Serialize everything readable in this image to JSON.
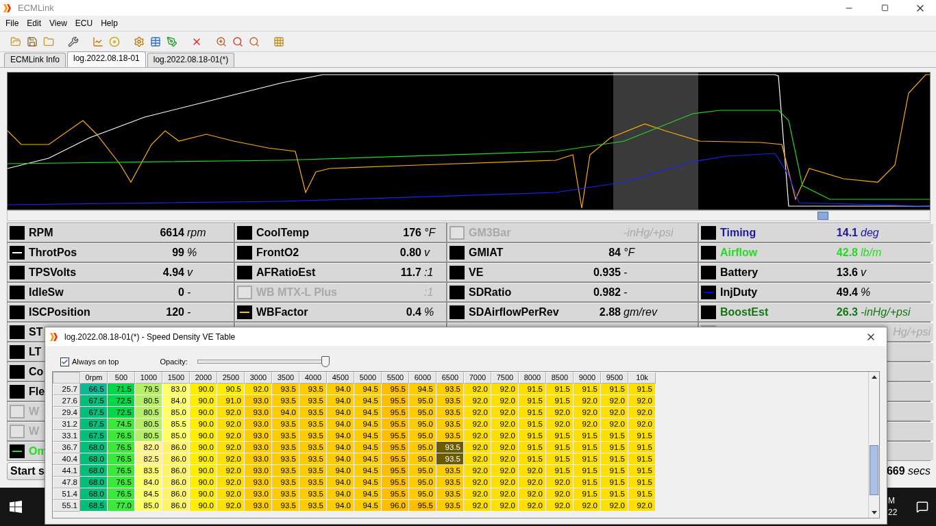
{
  "window": {
    "title": "ECMLink"
  },
  "menu": [
    "File",
    "Edit",
    "View",
    "ECU",
    "Help"
  ],
  "tabs": [
    {
      "label": "ECMLink Info",
      "selected": false
    },
    {
      "label": "log.2022.08.18-01",
      "selected": true
    },
    {
      "label": "log.2022.08.18-01(*)",
      "selected": false
    }
  ],
  "gauges": {
    "rows": [
      [
        {
          "name": "RPM",
          "value": "6614",
          "unit": "rpm",
          "disabled": false,
          "swatch": {
            "kind": "box"
          }
        },
        {
          "name": "CoolTemp",
          "value": "176",
          "unit": "°F",
          "disabled": false,
          "swatch": {
            "kind": "box"
          }
        },
        {
          "name": "GM3Bar",
          "unit": "-inHg/+psi",
          "disabled": true
        },
        {
          "name": "Timing",
          "value": "14.1",
          "unit": "deg",
          "color": "#1a1a9c",
          "disabled": false,
          "swatch": {
            "kind": "box"
          }
        }
      ],
      [
        {
          "name": "ThrotPos",
          "value": "99",
          "unit": "%",
          "disabled": false,
          "swatch": {
            "kind": "line",
            "color": "#ffffff"
          }
        },
        {
          "name": "FrontO2",
          "value": "0.80",
          "unit": "v",
          "disabled": false,
          "swatch": {
            "kind": "box"
          }
        },
        {
          "name": "GMIAT",
          "value": "84",
          "unit": "°F",
          "disabled": false,
          "swatch": {
            "kind": "box"
          }
        },
        {
          "name": "Airflow",
          "value": "42.8",
          "unit": "lb/m",
          "color": "#22dd22",
          "disabled": false,
          "swatch": {
            "kind": "box"
          }
        }
      ],
      [
        {
          "name": "TPSVolts",
          "value": "4.94",
          "unit": "v",
          "disabled": false,
          "swatch": {
            "kind": "box"
          }
        },
        {
          "name": "AFRatioEst",
          "value": "11.7",
          "unit": ":1",
          "disabled": false,
          "swatch": {
            "kind": "box"
          }
        },
        {
          "name": "VE",
          "value": "0.935",
          "unit": "-",
          "disabled": false,
          "swatch": {
            "kind": "box"
          }
        },
        {
          "name": "Battery",
          "value": "13.6",
          "unit": "v",
          "disabled": false,
          "swatch": {
            "kind": "box"
          }
        }
      ],
      [
        {
          "name": "IdleSw",
          "value": "0",
          "unit": "-",
          "disabled": false,
          "swatch": {
            "kind": "box"
          }
        },
        {
          "name": "WB MTX-L Plus",
          "unit": ":1",
          "disabled": true
        },
        {
          "name": "SDRatio",
          "value": "0.982",
          "unit": "-",
          "disabled": false,
          "swatch": {
            "kind": "box"
          }
        },
        {
          "name": "InjDuty",
          "value": "49.4",
          "unit": "%",
          "disabled": false,
          "swatch": {
            "kind": "line",
            "color": "#0000ff"
          }
        }
      ],
      [
        {
          "name": "ISCPosition",
          "value": "120",
          "unit": "-",
          "disabled": false,
          "swatch": {
            "kind": "box"
          }
        },
        {
          "name": "WBFactor",
          "value": "0.4",
          "unit": "%",
          "disabled": false,
          "swatch": {
            "kind": "line",
            "color": "#ffc000"
          }
        },
        {
          "name": "SDAirflowPerRev",
          "value": "2.88",
          "unit": "gm/rev",
          "disabled": false,
          "swatch": {
            "kind": "box"
          }
        },
        {
          "name": "BoostEst",
          "value": "26.3",
          "unit": "-inHg/+psi",
          "color": "#117711",
          "disabled": false,
          "swatch": {
            "kind": "box"
          }
        }
      ]
    ],
    "covered_rows": [
      {
        "left": {
          "name": "ST",
          "disabled": false,
          "swatch": {
            "kind": "box"
          }
        },
        "right": {
          "unit": "Hg/+psi",
          "disabled": true
        }
      },
      {
        "left": {
          "name": "LT",
          "disabled": false,
          "swatch": {
            "kind": "box"
          }
        }
      },
      {
        "left": {
          "name": "Co",
          "disabled": false,
          "swatch": {
            "kind": "box"
          }
        }
      },
      {
        "left": {
          "name": "Fle",
          "disabled": false,
          "swatch": {
            "kind": "box"
          }
        }
      },
      {
        "left": {
          "name": "W",
          "disabled": true
        }
      },
      {
        "left": {
          "name": "W",
          "disabled": true
        }
      },
      {
        "left": {
          "name": "Om",
          "color": "#22dd22",
          "disabled": false,
          "swatch": {
            "kind": "line",
            "color": "#22dd22"
          }
        }
      }
    ]
  },
  "footer": {
    "button": "Start s",
    "elapsed": "669",
    "elapsed_unit": "secs"
  },
  "taskbar": {
    "clock": [
      "M",
      "22"
    ]
  },
  "dialog": {
    "title": "log.2022.08.18-01(*) - Speed Density VE Table",
    "always_on_top": {
      "label": "Always on top",
      "checked": true
    },
    "opacity": {
      "label": "Opacity:",
      "level": 0.97
    },
    "table": {
      "columns": [
        "0rpm",
        "500",
        "1000",
        "1500",
        "2000",
        "2500",
        "3000",
        "3500",
        "4000",
        "4500",
        "5000",
        "5500",
        "6000",
        "6500",
        "7000",
        "7500",
        "8000",
        "8500",
        "9000",
        "9500",
        "10k"
      ],
      "rows": [
        {
          "label": "25.7",
          "cells": [
            {
              "value": "66.5",
              "selected": false
            },
            {
              "value": "71.5",
              "selected": false
            },
            {
              "value": "79.5",
              "selected": false
            },
            {
              "value": "83.0",
              "selected": false
            },
            {
              "value": "90.0",
              "selected": false
            },
            {
              "value": "90.5",
              "selected": false
            },
            {
              "value": "92.0",
              "selected": false
            },
            {
              "value": "93.5",
              "selected": false
            },
            {
              "value": "93.5",
              "selected": false
            },
            {
              "value": "94.0",
              "selected": false
            },
            {
              "value": "94.5",
              "selected": false
            },
            {
              "value": "95.5",
              "selected": false
            },
            {
              "value": "94.5",
              "selected": false
            },
            {
              "value": "93.5",
              "selected": false
            },
            {
              "value": "92.0",
              "selected": false
            },
            {
              "value": "92.0",
              "selected": false
            },
            {
              "value": "91.5",
              "selected": false
            },
            {
              "value": "91.5",
              "selected": false
            },
            {
              "value": "91.5",
              "selected": false
            },
            {
              "value": "91.5",
              "selected": false
            },
            {
              "value": "91.5",
              "selected": false
            }
          ]
        },
        {
          "label": "27.6",
          "cells": [
            {
              "value": "67.5",
              "selected": false
            },
            {
              "value": "72.5",
              "selected": false
            },
            {
              "value": "80.5",
              "selected": false
            },
            {
              "value": "84.0",
              "selected": false
            },
            {
              "value": "90.0",
              "selected": false
            },
            {
              "value": "91.0",
              "selected": false
            },
            {
              "value": "93.0",
              "selected": false
            },
            {
              "value": "93.5",
              "selected": false
            },
            {
              "value": "93.5",
              "selected": false
            },
            {
              "value": "94.0",
              "selected": false
            },
            {
              "value": "94.5",
              "selected": false
            },
            {
              "value": "95.5",
              "selected": false
            },
            {
              "value": "95.0",
              "selected": false
            },
            {
              "value": "93.5",
              "selected": false
            },
            {
              "value": "92.0",
              "selected": false
            },
            {
              "value": "92.0",
              "selected": false
            },
            {
              "value": "91.5",
              "selected": false
            },
            {
              "value": "91.5",
              "selected": false
            },
            {
              "value": "92.0",
              "selected": false
            },
            {
              "value": "92.0",
              "selected": false
            },
            {
              "value": "92.0",
              "selected": false
            }
          ]
        },
        {
          "label": "29.4",
          "cells": [
            {
              "value": "67.5",
              "selected": false
            },
            {
              "value": "72.5",
              "selected": false
            },
            {
              "value": "80.5",
              "selected": false
            },
            {
              "value": "85.0",
              "selected": false
            },
            {
              "value": "90.0",
              "selected": false
            },
            {
              "value": "92.0",
              "selected": false
            },
            {
              "value": "93.0",
              "selected": false
            },
            {
              "value": "94.0",
              "selected": false
            },
            {
              "value": "93.5",
              "selected": false
            },
            {
              "value": "94.0",
              "selected": false
            },
            {
              "value": "94.5",
              "selected": false
            },
            {
              "value": "95.5",
              "selected": false
            },
            {
              "value": "95.0",
              "selected": false
            },
            {
              "value": "93.5",
              "selected": false
            },
            {
              "value": "92.0",
              "selected": false
            },
            {
              "value": "92.0",
              "selected": false
            },
            {
              "value": "91.5",
              "selected": false
            },
            {
              "value": "92.0",
              "selected": false
            },
            {
              "value": "92.0",
              "selected": false
            },
            {
              "value": "92.0",
              "selected": false
            },
            {
              "value": "92.0",
              "selected": false
            }
          ]
        },
        {
          "label": "31.2",
          "cells": [
            {
              "value": "67.5",
              "selected": false
            },
            {
              "value": "74.5",
              "selected": false
            },
            {
              "value": "80.5",
              "selected": false
            },
            {
              "value": "85.5",
              "selected": false
            },
            {
              "value": "90.0",
              "selected": false
            },
            {
              "value": "92.0",
              "selected": false
            },
            {
              "value": "93.0",
              "selected": false
            },
            {
              "value": "93.5",
              "selected": false
            },
            {
              "value": "93.5",
              "selected": false
            },
            {
              "value": "94.0",
              "selected": false
            },
            {
              "value": "94.5",
              "selected": false
            },
            {
              "value": "95.5",
              "selected": false
            },
            {
              "value": "95.0",
              "selected": false
            },
            {
              "value": "93.5",
              "selected": false
            },
            {
              "value": "92.0",
              "selected": false
            },
            {
              "value": "92.0",
              "selected": false
            },
            {
              "value": "91.5",
              "selected": false
            },
            {
              "value": "92.0",
              "selected": false
            },
            {
              "value": "92.0",
              "selected": false
            },
            {
              "value": "92.0",
              "selected": false
            },
            {
              "value": "92.0",
              "selected": false
            }
          ]
        },
        {
          "label": "33.1",
          "cells": [
            {
              "value": "67.5",
              "selected": false
            },
            {
              "value": "76.5",
              "selected": false
            },
            {
              "value": "80.5",
              "selected": false
            },
            {
              "value": "85.0",
              "selected": false
            },
            {
              "value": "90.0",
              "selected": false
            },
            {
              "value": "92.0",
              "selected": false
            },
            {
              "value": "93.0",
              "selected": false
            },
            {
              "value": "93.5",
              "selected": false
            },
            {
              "value": "93.5",
              "selected": false
            },
            {
              "value": "94.0",
              "selected": false
            },
            {
              "value": "94.5",
              "selected": false
            },
            {
              "value": "95.5",
              "selected": false
            },
            {
              "value": "95.0",
              "selected": false
            },
            {
              "value": "93.5",
              "selected": false
            },
            {
              "value": "92.0",
              "selected": false
            },
            {
              "value": "92.0",
              "selected": false
            },
            {
              "value": "91.5",
              "selected": false
            },
            {
              "value": "91.5",
              "selected": false
            },
            {
              "value": "91.5",
              "selected": false
            },
            {
              "value": "91.5",
              "selected": false
            },
            {
              "value": "91.5",
              "selected": false
            }
          ]
        },
        {
          "label": "36.7",
          "cells": [
            {
              "value": "68.0",
              "selected": false
            },
            {
              "value": "76.5",
              "selected": false
            },
            {
              "value": "82.0",
              "selected": false
            },
            {
              "value": "86.0",
              "selected": false
            },
            {
              "value": "90.0",
              "selected": false
            },
            {
              "value": "92.0",
              "selected": false
            },
            {
              "value": "93.0",
              "selected": false
            },
            {
              "value": "93.5",
              "selected": false
            },
            {
              "value": "93.5",
              "selected": false
            },
            {
              "value": "94.0",
              "selected": false
            },
            {
              "value": "94.5",
              "selected": false
            },
            {
              "value": "95.5",
              "selected": false
            },
            {
              "value": "95.0",
              "selected": false
            },
            {
              "value": "93.5",
              "selected": true
            },
            {
              "value": "92.0",
              "selected": false
            },
            {
              "value": "92.0",
              "selected": false
            },
            {
              "value": "91.5",
              "selected": false
            },
            {
              "value": "91.5",
              "selected": false
            },
            {
              "value": "91.5",
              "selected": false
            },
            {
              "value": "91.5",
              "selected": false
            },
            {
              "value": "91.5",
              "selected": false
            }
          ]
        },
        {
          "label": "40.4",
          "cells": [
            {
              "value": "68.0",
              "selected": false
            },
            {
              "value": "76.5",
              "selected": false
            },
            {
              "value": "82.5",
              "selected": false
            },
            {
              "value": "86.0",
              "selected": false
            },
            {
              "value": "90.0",
              "selected": false
            },
            {
              "value": "92.0",
              "selected": false
            },
            {
              "value": "93.0",
              "selected": false
            },
            {
              "value": "93.5",
              "selected": false
            },
            {
              "value": "93.5",
              "selected": false
            },
            {
              "value": "94.0",
              "selected": false
            },
            {
              "value": "94.5",
              "selected": false
            },
            {
              "value": "95.5",
              "selected": false
            },
            {
              "value": "95.0",
              "selected": false
            },
            {
              "value": "93.5",
              "selected": true
            },
            {
              "value": "92.0",
              "selected": false
            },
            {
              "value": "92.0",
              "selected": false
            },
            {
              "value": "91.5",
              "selected": false
            },
            {
              "value": "91.5",
              "selected": false
            },
            {
              "value": "91.5",
              "selected": false
            },
            {
              "value": "91.5",
              "selected": false
            },
            {
              "value": "91.5",
              "selected": false
            }
          ]
        },
        {
          "label": "44.1",
          "cells": [
            {
              "value": "68.0",
              "selected": false
            },
            {
              "value": "76.5",
              "selected": false
            },
            {
              "value": "83.5",
              "selected": false
            },
            {
              "value": "86.0",
              "selected": false
            },
            {
              "value": "90.0",
              "selected": false
            },
            {
              "value": "92.0",
              "selected": false
            },
            {
              "value": "93.0",
              "selected": false
            },
            {
              "value": "93.5",
              "selected": false
            },
            {
              "value": "93.5",
              "selected": false
            },
            {
              "value": "94.0",
              "selected": false
            },
            {
              "value": "94.5",
              "selected": false
            },
            {
              "value": "95.5",
              "selected": false
            },
            {
              "value": "95.0",
              "selected": false
            },
            {
              "value": "93.5",
              "selected": false
            },
            {
              "value": "92.0",
              "selected": false
            },
            {
              "value": "92.0",
              "selected": false
            },
            {
              "value": "92.0",
              "selected": false
            },
            {
              "value": "91.5",
              "selected": false
            },
            {
              "value": "91.5",
              "selected": false
            },
            {
              "value": "91.5",
              "selected": false
            },
            {
              "value": "91.5",
              "selected": false
            }
          ]
        },
        {
          "label": "47.8",
          "cells": [
            {
              "value": "68.0",
              "selected": false
            },
            {
              "value": "76.5",
              "selected": false
            },
            {
              "value": "84.0",
              "selected": false
            },
            {
              "value": "86.0",
              "selected": false
            },
            {
              "value": "90.0",
              "selected": false
            },
            {
              "value": "92.0",
              "selected": false
            },
            {
              "value": "93.0",
              "selected": false
            },
            {
              "value": "93.5",
              "selected": false
            },
            {
              "value": "93.5",
              "selected": false
            },
            {
              "value": "94.0",
              "selected": false
            },
            {
              "value": "94.5",
              "selected": false
            },
            {
              "value": "95.5",
              "selected": false
            },
            {
              "value": "95.0",
              "selected": false
            },
            {
              "value": "93.5",
              "selected": false
            },
            {
              "value": "92.0",
              "selected": false
            },
            {
              "value": "92.0",
              "selected": false
            },
            {
              "value": "92.0",
              "selected": false
            },
            {
              "value": "92.0",
              "selected": false
            },
            {
              "value": "91.5",
              "selected": false
            },
            {
              "value": "91.5",
              "selected": false
            },
            {
              "value": "91.5",
              "selected": false
            }
          ]
        },
        {
          "label": "51.4",
          "cells": [
            {
              "value": "68.0",
              "selected": false
            },
            {
              "value": "76.5",
              "selected": false
            },
            {
              "value": "84.5",
              "selected": false
            },
            {
              "value": "86.0",
              "selected": false
            },
            {
              "value": "90.0",
              "selected": false
            },
            {
              "value": "92.0",
              "selected": false
            },
            {
              "value": "93.0",
              "selected": false
            },
            {
              "value": "93.5",
              "selected": false
            },
            {
              "value": "93.5",
              "selected": false
            },
            {
              "value": "94.0",
              "selected": false
            },
            {
              "value": "94.5",
              "selected": false
            },
            {
              "value": "95.5",
              "selected": false
            },
            {
              "value": "95.0",
              "selected": false
            },
            {
              "value": "93.5",
              "selected": false
            },
            {
              "value": "92.0",
              "selected": false
            },
            {
              "value": "92.0",
              "selected": false
            },
            {
              "value": "92.0",
              "selected": false
            },
            {
              "value": "92.0",
              "selected": false
            },
            {
              "value": "91.5",
              "selected": false
            },
            {
              "value": "91.5",
              "selected": false
            },
            {
              "value": "91.5",
              "selected": false
            }
          ]
        },
        {
          "label": "55.1",
          "cells": [
            {
              "value": "68.5",
              "selected": false
            },
            {
              "value": "77.0",
              "selected": false
            },
            {
              "value": "85.0",
              "selected": false
            },
            {
              "value": "86.0",
              "selected": false
            },
            {
              "value": "90.0",
              "selected": false
            },
            {
              "value": "92.0",
              "selected": false
            },
            {
              "value": "93.0",
              "selected": false
            },
            {
              "value": "93.5",
              "selected": false
            },
            {
              "value": "93.5",
              "selected": false
            },
            {
              "value": "94.0",
              "selected": false
            },
            {
              "value": "94.5",
              "selected": false
            },
            {
              "value": "96.0",
              "selected": false
            },
            {
              "value": "95.5",
              "selected": false
            },
            {
              "value": "93.5",
              "selected": false
            },
            {
              "value": "92.0",
              "selected": false
            },
            {
              "value": "92.0",
              "selected": false
            },
            {
              "value": "92.0",
              "selected": false
            },
            {
              "value": "92.0",
              "selected": false
            },
            {
              "value": "92.0",
              "selected": false
            },
            {
              "value": "92.0",
              "selected": false
            },
            {
              "value": "92.0",
              "selected": false
            }
          ]
        }
      ]
    }
  }
}
